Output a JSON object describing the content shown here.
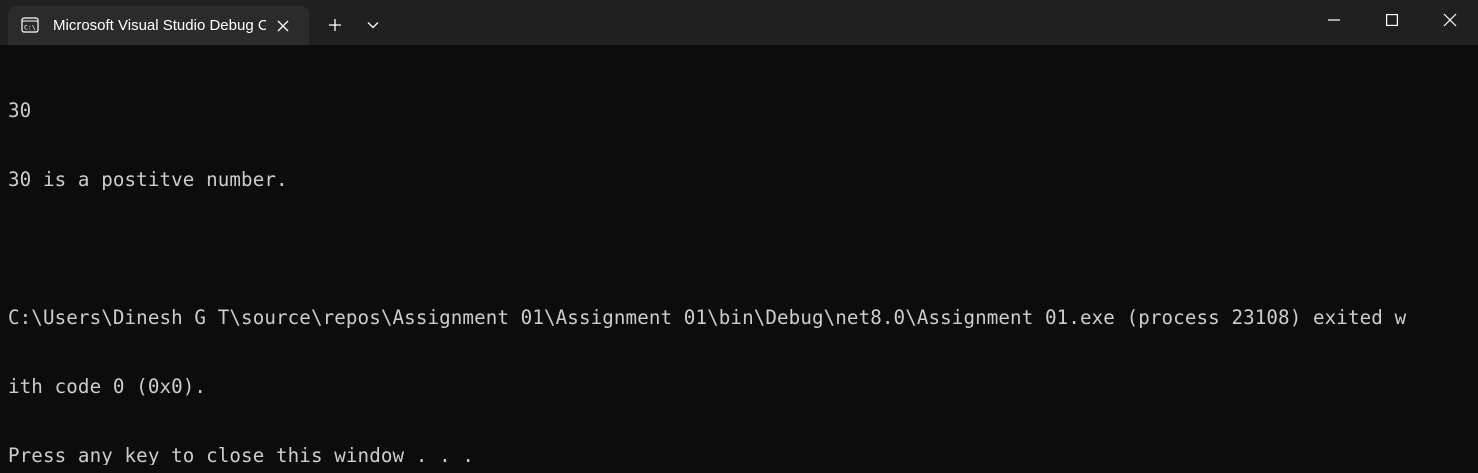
{
  "window": {
    "tab_title": "Microsoft Visual Studio Debug Console",
    "tab_icon": "terminal-icon",
    "close_tab_icon": "close-icon",
    "new_tab_icon": "plus-icon",
    "dropdown_icon": "chevron-down-icon",
    "minimize_icon": "minimize-icon",
    "maximize_icon": "maximize-icon",
    "close_window_icon": "close-icon"
  },
  "colors": {
    "titlebar_bg": "#202020",
    "tab_bg": "#2b2b2b",
    "console_bg": "#0c0c0c",
    "console_text": "#cccccc"
  },
  "console": {
    "lines": [
      "30",
      "30 is a postitve number.",
      "",
      "C:\\Users\\Dinesh G T\\source\\repos\\Assignment 01\\Assignment 01\\bin\\Debug\\net8.0\\Assignment 01.exe (process 23108) exited w",
      "ith code 0 (0x0).",
      "Press any key to close this window . . ."
    ]
  }
}
